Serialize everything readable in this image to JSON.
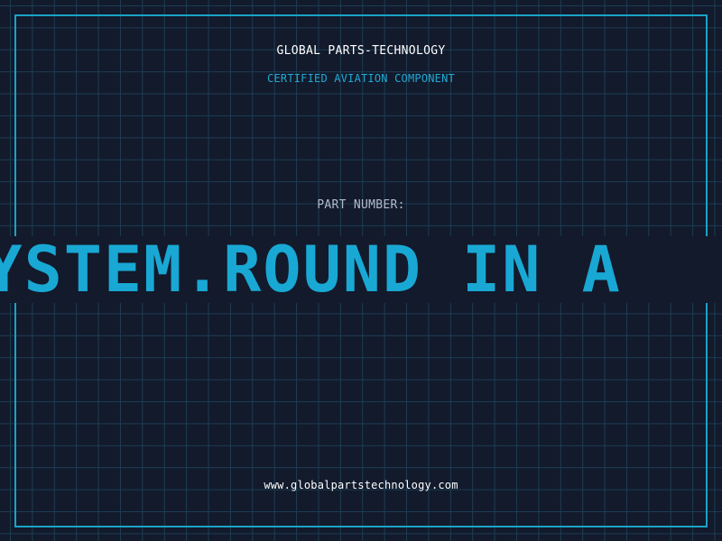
{
  "header": {
    "brand": "GLOBAL PARTS-TECHNOLOGY",
    "tagline": "CERTIFIED AVIATION COMPONENT"
  },
  "part": {
    "label": "PART NUMBER:",
    "value": "E SYSTEM.ROUND IN A"
  },
  "footer": {
    "url": "www.globalpartstechnology.com"
  },
  "colors": {
    "background": "#121a2c",
    "grid": "#1d3d52",
    "accent": "#19a8d4",
    "text": "#ffffff",
    "muted": "#b3bccb"
  }
}
